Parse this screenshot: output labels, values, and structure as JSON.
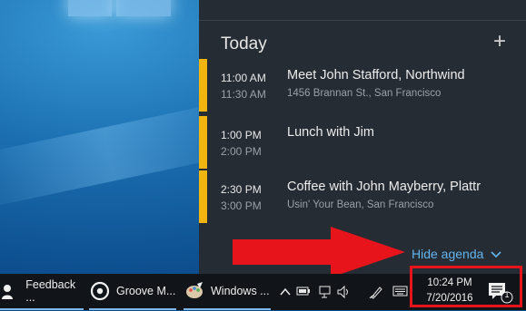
{
  "agenda": {
    "header": "Today",
    "add_label": "+",
    "events": [
      {
        "start": "11:00 AM",
        "end": "11:30 AM",
        "title": "Meet John Stafford, Northwind",
        "location": "1456 Brannan St., San Francisco"
      },
      {
        "start": "1:00 PM",
        "end": "2:00 PM",
        "title": "Lunch with Jim",
        "location": ""
      },
      {
        "start": "2:30 PM",
        "end": "3:00 PM",
        "title": "Coffee with John Mayberry, Plattr",
        "location": "Usin' Your Bean, San Francisco"
      }
    ],
    "hide_label": "Hide agenda",
    "accent_color": "#f2b40f",
    "link_color": "#62b5f0"
  },
  "taskbar": {
    "apps": [
      {
        "label": "Feedback ...",
        "icon": "feedback-hub-icon"
      },
      {
        "label": "Groove M...",
        "icon": "groove-music-icon"
      },
      {
        "label": "Windows ...",
        "icon": "windows-ink-icon"
      }
    ],
    "tray_icons": [
      "chevron-up-icon",
      "battery-icon",
      "network-icon",
      "volume-icon",
      "pen-icon",
      "keyboard-icon"
    ],
    "clock": {
      "time": "10:24 PM",
      "date": "7/20/2016"
    },
    "notification_count": "1"
  },
  "annotation_color": "#e8141c"
}
